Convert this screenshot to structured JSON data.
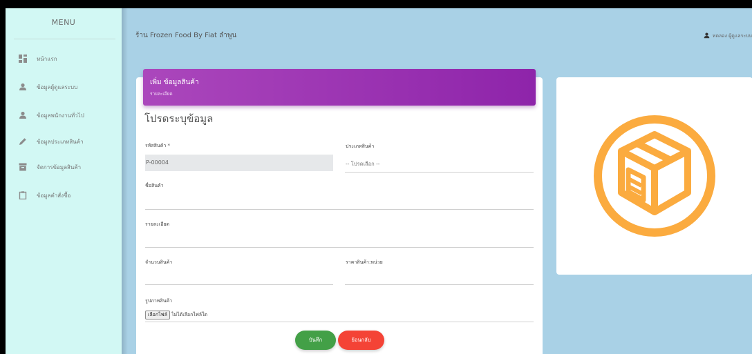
{
  "sidebar": {
    "title": "MENU",
    "items": [
      {
        "label": "หน้าแรก",
        "icon": "dashboard-icon"
      },
      {
        "label": "ข้อมูลผู้ดูแลระบบ",
        "icon": "person-icon"
      },
      {
        "label": "ข้อมูลพนักงานทั่วไป",
        "icon": "person-icon"
      },
      {
        "label": "ข้อมูลประเภทสินค้า",
        "icon": "pencil-icon"
      },
      {
        "label": "จัดการข้อมูลสินค้า",
        "icon": "archive-icon"
      },
      {
        "label": "ข้อมูลคำสั่งซื้อ",
        "icon": "clipboard-icon"
      }
    ]
  },
  "header": {
    "store_title": "ร้าน Frozen Food By Fiat ลำพูน",
    "user_label": "ทดลอง ผู้ดูแลระบบ"
  },
  "form": {
    "card_title": "เพิ่ม ข้อมูลสินค้า",
    "card_subtitle": "รายละเอียด",
    "heading": "โปรดระบุข้อมูล",
    "product_code_label": "รหัสสินค้า *",
    "product_code_value": "P-00004",
    "category_label": "ประเภทสินค้า",
    "category_value": "-- โปรดเลือก --",
    "name_label": "ชื่อสินค้า",
    "detail_label": "รายละเอียด",
    "quantity_label": "จำนวนสินค้า",
    "price_label": "ราคาสินค้า:หน่วย",
    "image_label": "รูปภาพสินค้า",
    "file_button": "เลือกไฟล์",
    "file_none": "ไม่ได้เลือกไฟล์ใด",
    "save_button": "บันทึก",
    "back_button": "ย้อนกลับ"
  },
  "colors": {
    "sidebar_bg": "#d2f8f4",
    "page_bg": "#a9d1e6",
    "header_purple": "#9c27b0",
    "save_green": "#43a047",
    "back_red": "#f44336",
    "box_icon_orange": "#fbab3f"
  },
  "image_card": {
    "icon": "box-icon"
  }
}
